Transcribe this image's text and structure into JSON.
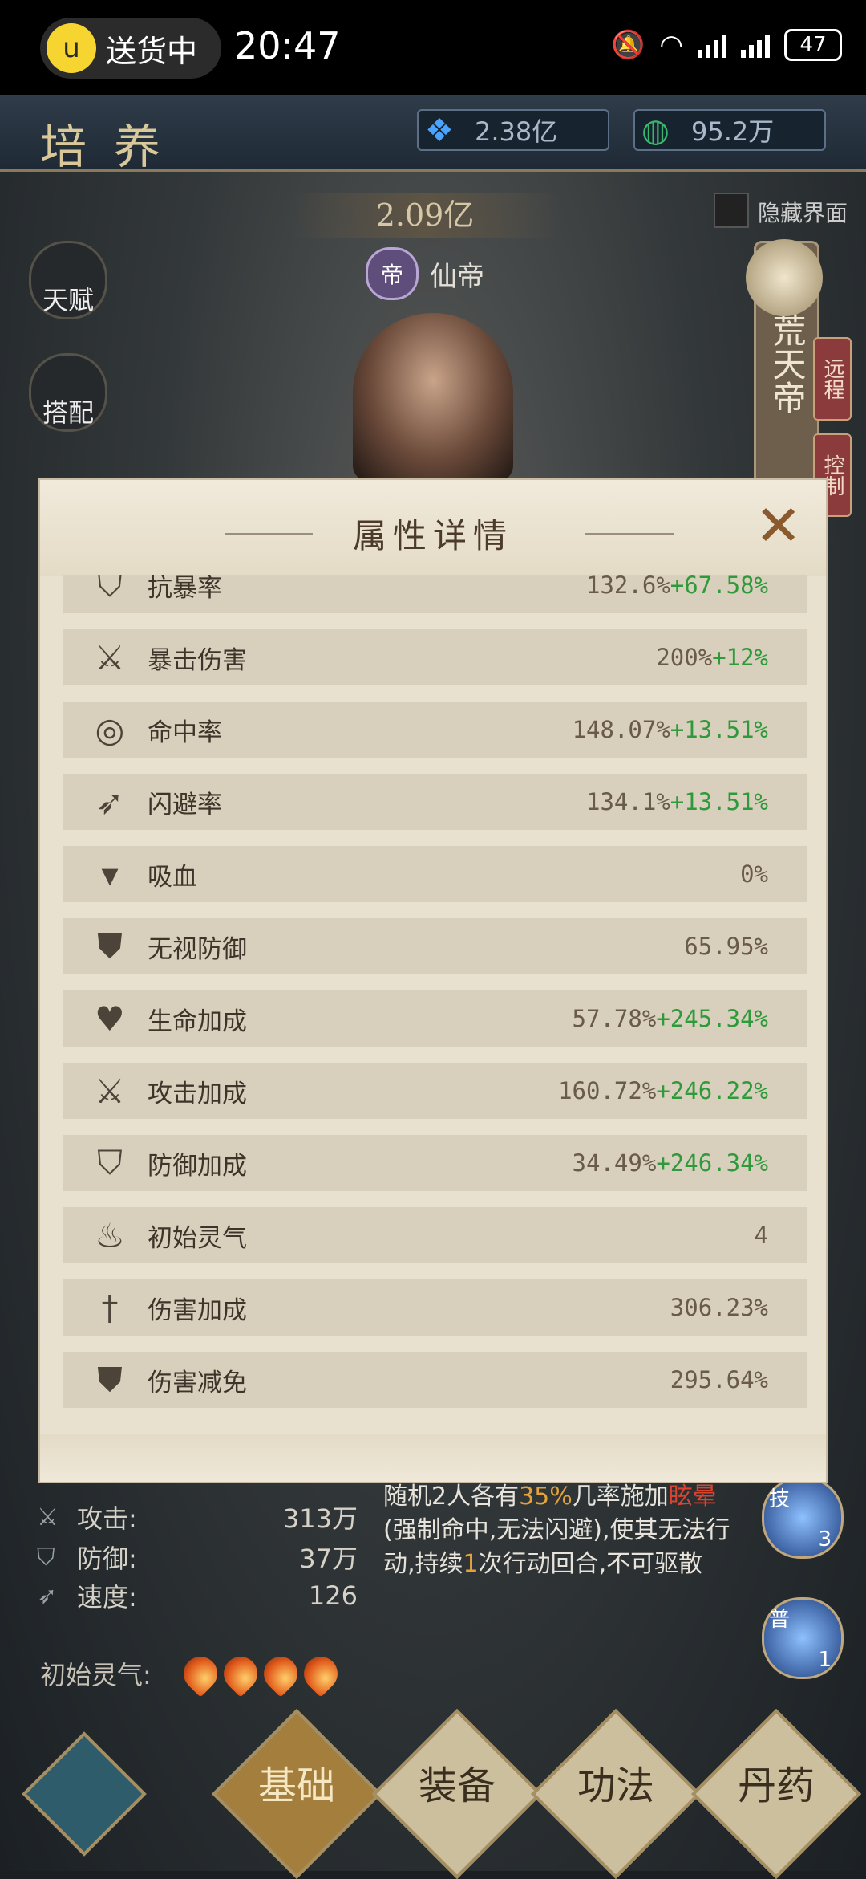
{
  "statusbar": {
    "delivery_label": "送货中",
    "time": "20:47",
    "battery": "47"
  },
  "header": {
    "title": "培养",
    "resource_1": "2.38亿",
    "resource_2": "95.2万"
  },
  "hero_panel": {
    "power": "2.09亿",
    "rank_badge": "帝",
    "rank_name": "仙帝",
    "hide_ui_label": "隐藏界面",
    "hero_name": "荒天帝",
    "tag_1": "远程",
    "tag_2": "控制",
    "side_buttons": [
      "天赋",
      "搭配"
    ]
  },
  "modal": {
    "title": "属性详情",
    "rows": [
      {
        "icon": "shield-icon",
        "glyph": "⛉",
        "name": "抗暴率",
        "base": "132.6%",
        "bonus": "+67.58%"
      },
      {
        "icon": "crit-sword-icon",
        "glyph": "⚔",
        "name": "暴击伤害",
        "base": "200%",
        "bonus": "+12%"
      },
      {
        "icon": "target-icon",
        "glyph": "◎",
        "name": "命中率",
        "base": "148.07%",
        "bonus": "+13.51%"
      },
      {
        "icon": "wing-icon",
        "glyph": "➶",
        "name": "闪避率",
        "base": "134.1%",
        "bonus": "+13.51%"
      },
      {
        "icon": "fang-icon",
        "glyph": "▾",
        "name": "吸血",
        "base": "0%",
        "bonus": ""
      },
      {
        "icon": "broken-shield-icon",
        "glyph": "⛊",
        "name": "无视防御",
        "base": "65.95%",
        "bonus": ""
      },
      {
        "icon": "heart-plus-icon",
        "glyph": "♥",
        "name": "生命加成",
        "base": "57.78%",
        "bonus": "+245.34%"
      },
      {
        "icon": "sword-plus-icon",
        "glyph": "⚔",
        "name": "攻击加成",
        "base": "160.72%",
        "bonus": "+246.22%"
      },
      {
        "icon": "shield-plus-icon",
        "glyph": "⛉",
        "name": "防御加成",
        "base": "34.49%",
        "bonus": "+246.34%"
      },
      {
        "icon": "flame-icon",
        "glyph": "♨",
        "name": "初始灵气",
        "base": "4",
        "bonus": ""
      },
      {
        "icon": "sword-up-icon",
        "glyph": "†",
        "name": "伤害加成",
        "base": "306.23%",
        "bonus": ""
      },
      {
        "icon": "shield-down-icon",
        "glyph": "⛊",
        "name": "伤害减免",
        "base": "295.64%",
        "bonus": ""
      }
    ]
  },
  "stats": {
    "attack_label": "攻击:",
    "attack_value": "313万",
    "defense_label": "防御:",
    "defense_value": "37万",
    "speed_label": "速度:",
    "speed_value": "126",
    "lingqi_label": "初始灵气:"
  },
  "skill": {
    "line_prefix": "随机2人各有",
    "chance": "35%",
    "line_mid": "几率施加",
    "status": "眩晕",
    "line_rest": "(强制命中,无法闪避),使其无法行动,持续",
    "turns": "1",
    "line_end": "次行动回合,不可驱散",
    "icon_1_tag": "技",
    "icon_1_count": "3",
    "icon_2_tag": "普",
    "icon_2_count": "1"
  },
  "nav": {
    "tab_1": "基础",
    "tab_2": "装备",
    "tab_3": "功法",
    "tab_4": "丹药"
  }
}
